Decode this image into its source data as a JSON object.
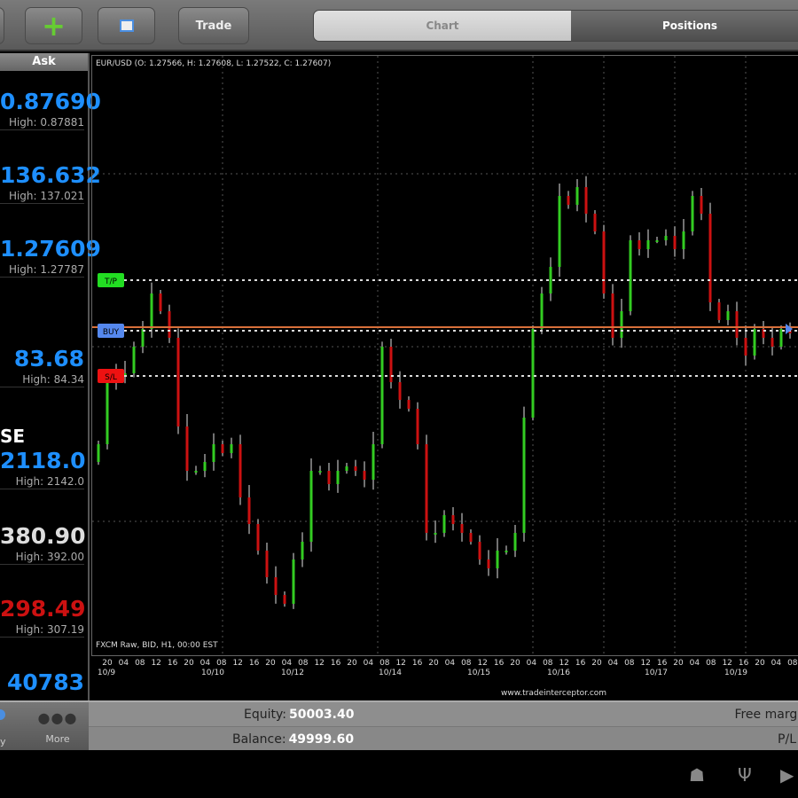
{
  "toolbar": {
    "trade_label": "Trade",
    "tabs": [
      "Chart",
      "Positions"
    ]
  },
  "watchlist": {
    "header": "Ask",
    "section_label": "SE",
    "items": [
      {
        "price": "0.87690",
        "high": "High: 0.87881",
        "color": "#1e8fff"
      },
      {
        "price": "136.632",
        "high": "High: 137.021",
        "color": "#1e8fff"
      },
      {
        "price": "1.27609",
        "high": "High: 1.27787",
        "color": "#1e8fff"
      },
      {
        "price": "83.68",
        "high": "High: 84.34",
        "color": "#1e8fff"
      },
      {
        "price": "2118.0",
        "high": "High: 2142.0",
        "color": "#1e8fff"
      },
      {
        "price": "380.90",
        "high": "High: 392.00",
        "color": "#dddddd"
      },
      {
        "price": "298.49",
        "high": "High: 307.19",
        "color": "#cc1111"
      },
      {
        "price": "40783",
        "high": "",
        "color": "#1e8fff"
      }
    ]
  },
  "chart_data": {
    "type": "candlestick",
    "title": "EUR/USD (O: 1.27566, H: 1.27608, L: 1.27522, C: 1.27607)",
    "footer": "FXCM Raw, BID, H1, 00:00 EST",
    "watermark": "www.tradeinterceptor.com",
    "ylim": [
      1.26497,
      1.28522
    ],
    "closes": [
      1.27217,
      1.27427,
      1.27457,
      1.27457,
      1.27547,
      1.27607,
      1.27727,
      1.27667,
      1.27577,
      1.27277,
      1.27127,
      1.27127,
      1.27157,
      1.27217,
      1.27187,
      1.27217,
      1.27037,
      1.26947,
      1.26857,
      1.26767,
      1.26707,
      1.26677,
      1.26827,
      1.26887,
      1.27127,
      1.27127,
      1.27082,
      1.27127,
      1.27142,
      1.27127,
      1.27097,
      1.27217,
      1.27547,
      1.27427,
      1.27367,
      1.27337,
      1.27217,
      1.26917,
      1.26917,
      1.26977,
      1.26947,
      1.26917,
      1.26887,
      1.26827,
      1.26797,
      1.26857,
      1.26857,
      1.26917,
      1.27307,
      1.27607,
      1.27727,
      1.27817,
      1.28057,
      1.28027,
      1.28087,
      1.27997,
      1.27937,
      1.27727,
      1.27577,
      1.27667,
      1.27907,
      1.27877,
      1.27907,
      1.27907,
      1.27922,
      1.27877,
      1.27937,
      1.28057,
      1.27997,
      1.27697,
      1.27637,
      1.27667,
      1.27577,
      1.27517,
      1.27607,
      1.27577,
      1.27547,
      1.27607,
      1.27592
    ],
    "levels": [
      {
        "label": "T/P",
        "price": 1.27778,
        "color": "#22dd22"
      },
      {
        "label": "BUY",
        "price": 1.27607,
        "color": "#5588ee"
      },
      {
        "label": "S/L",
        "price": 1.27454,
        "color": "#ee1111"
      }
    ],
    "up_color": "#33cc22",
    "down_color": "#cc1111",
    "entry_line_color": "#d8703a",
    "hour_ticks": [
      "20",
      "04",
      "08",
      "12",
      "16",
      "20",
      "04",
      "08",
      "12",
      "16",
      "20",
      "04",
      "08",
      "12",
      "16",
      "20",
      "04",
      "08",
      "12",
      "16",
      "20",
      "04",
      "08",
      "12",
      "16",
      "20",
      "04",
      "08",
      "12",
      "16",
      "20",
      "04",
      "08",
      "12",
      "16",
      "20",
      "04",
      "08",
      "12",
      "16",
      "20",
      "04",
      "08"
    ],
    "date_ticks": [
      {
        "label": "10/9",
        "at_candle": 1
      },
      {
        "label": "10/10",
        "at_candle": 13
      },
      {
        "label": "10/12",
        "at_candle": 22
      },
      {
        "label": "10/14",
        "at_candle": 33
      },
      {
        "label": "10/15",
        "at_candle": 43
      },
      {
        "label": "10/16",
        "at_candle": 52
      },
      {
        "label": "10/17",
        "at_candle": 63
      },
      {
        "label": "10/19",
        "at_candle": 72
      }
    ]
  },
  "account": {
    "equity_label": "Equity:",
    "equity": "50003.40",
    "balance_label": "Balance:",
    "balance": "49999.60",
    "free_margin_label": "Free margin",
    "pl_label": "P/L"
  },
  "nav": {
    "history_label": "y",
    "more_label": "More"
  }
}
